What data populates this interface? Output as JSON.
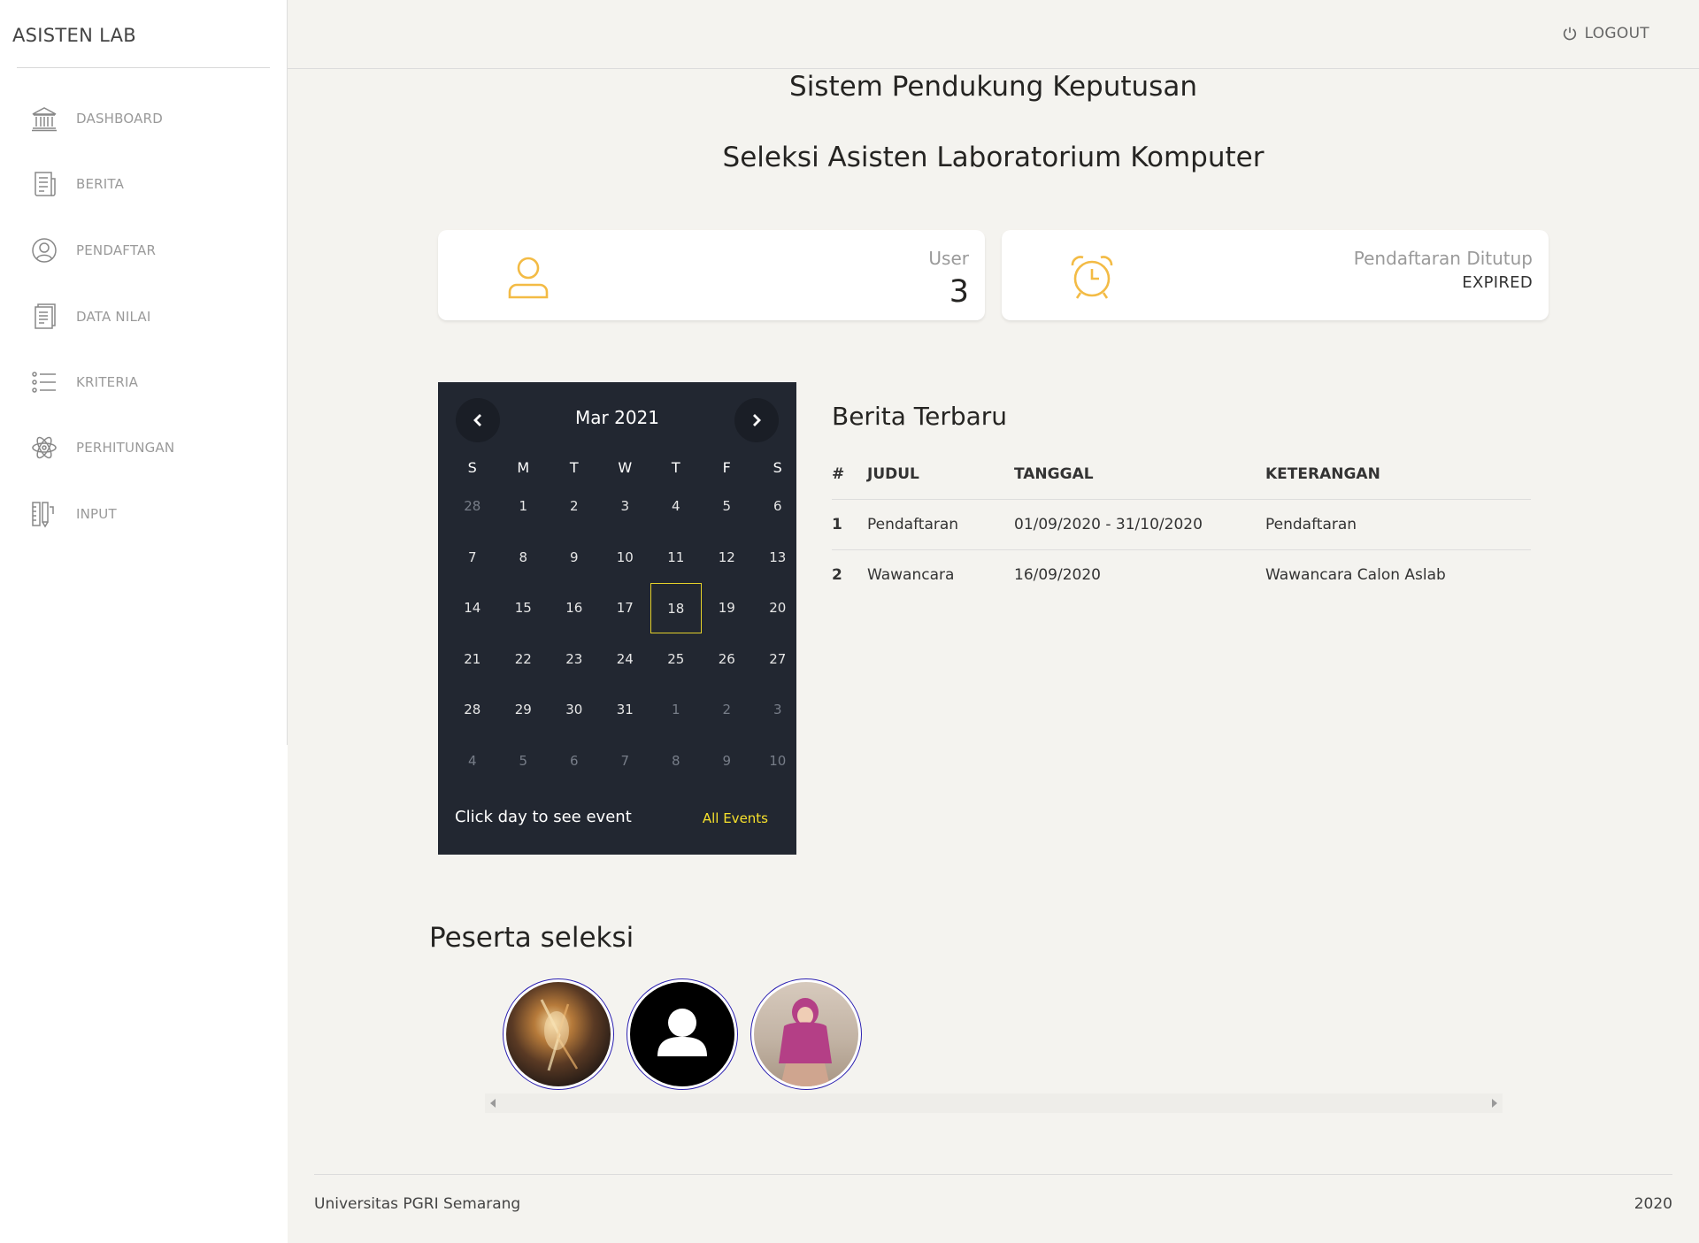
{
  "sidebar": {
    "brand": "ASISTEN LAB",
    "items": [
      {
        "label": "DASHBOARD",
        "icon": "bank-icon"
      },
      {
        "label": "BERITA",
        "icon": "news-icon"
      },
      {
        "label": "PENDAFTAR",
        "icon": "user-circle-icon"
      },
      {
        "label": "DATA NILAI",
        "icon": "document-icon"
      },
      {
        "label": "KRITERIA",
        "icon": "list-icon"
      },
      {
        "label": "PERHITUNGAN",
        "icon": "atom-icon"
      },
      {
        "label": "INPUT",
        "icon": "ruler-pencil-icon"
      }
    ]
  },
  "header": {
    "logout_label": "LOGOUT"
  },
  "main": {
    "title": "Sistem Pendukung Keputusan",
    "subtitle": "Seleksi Asisten Laboratorium Komputer"
  },
  "cards": {
    "user": {
      "title": "User",
      "value": "3",
      "icon": "user-icon"
    },
    "registration": {
      "title": "Pendaftaran Ditutup",
      "status": "EXPIRED",
      "icon": "alarm-clock-icon"
    }
  },
  "calendar": {
    "month": "Mar 2021",
    "weekdays": [
      "S",
      "M",
      "T",
      "W",
      "T",
      "F",
      "S"
    ],
    "weeks": [
      [
        "28",
        "1",
        "2",
        "3",
        "4",
        "5",
        "6"
      ],
      [
        "7",
        "8",
        "9",
        "10",
        "11",
        "12",
        "13"
      ],
      [
        "14",
        "15",
        "16",
        "17",
        "18",
        "19",
        "20"
      ],
      [
        "21",
        "22",
        "23",
        "24",
        "25",
        "26",
        "27"
      ],
      [
        "28",
        "29",
        "30",
        "31",
        "1",
        "2",
        "3"
      ],
      [
        "4",
        "5",
        "6",
        "7",
        "8",
        "9",
        "10"
      ]
    ],
    "today": "18",
    "footer_text": "Click day to see event",
    "all_events_label": "All Events"
  },
  "news": {
    "title": "Berita Terbaru",
    "columns": [
      "#",
      "JUDUL",
      "TANGGAL",
      "KETERANGAN"
    ],
    "rows": [
      [
        "1",
        "Pendaftaran",
        "01/09/2020 - 31/10/2020",
        "Pendaftaran"
      ],
      [
        "2",
        "Wawancara",
        "16/09/2020",
        "Wawancara Calon Aslab"
      ]
    ]
  },
  "participants": {
    "title": "Peserta seleksi",
    "count": 3
  },
  "footer": {
    "left": "Universitas PGRI Semarang",
    "right": "2020"
  },
  "colors": {
    "accent_icon": "#f3bb45",
    "calendar_bg": "#222731",
    "calendar_highlight": "#f7e12c",
    "page_bg": "#f4f3ef"
  }
}
